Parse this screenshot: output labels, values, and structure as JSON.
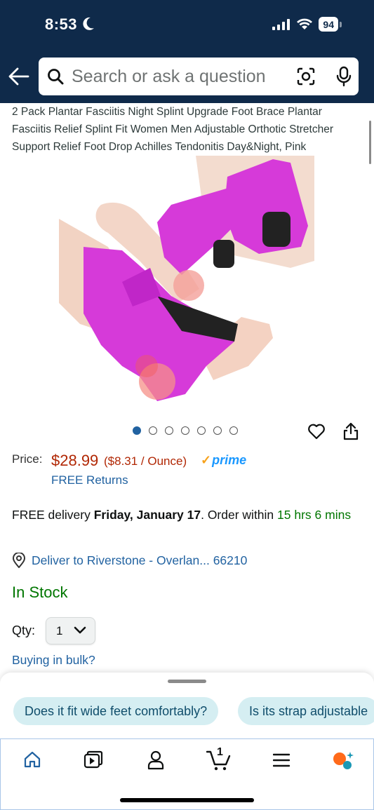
{
  "status_bar": {
    "time": "8:53",
    "battery": "94"
  },
  "search": {
    "placeholder": "Search or ask a question"
  },
  "product": {
    "title": "2 Pack Plantar Fasciitis Night Splint Upgrade Foot Brace Plantar Fasciitis Relief Splint Fit Women Men Adjustable Orthotic Stretcher Support Relief Foot Drop Achilles Tendonitis Day&Night, Pink",
    "image_count": 7,
    "active_image_index": 0
  },
  "pricing": {
    "label": "Price:",
    "price": "$28.99",
    "unit_price": "($8.31 / Ounce)",
    "prime": "prime",
    "returns": "FREE Returns"
  },
  "delivery": {
    "prefix": "FREE delivery ",
    "date": "Friday, January 17",
    "middle": ". Order within ",
    "countdown": "15 hrs 6 mins"
  },
  "location": {
    "text": "Deliver to Riverstone - Overlan... 66210"
  },
  "stock": {
    "status": "In Stock"
  },
  "quantity": {
    "label": "Qty:",
    "value": "1"
  },
  "bulk": {
    "label": "Buying in bulk?"
  },
  "suggestions": [
    {
      "text": "Does it fit wide feet comfortably?"
    },
    {
      "text": "Is its strap adjustable"
    }
  ],
  "nav": {
    "cart_count": "1",
    "items": [
      "home-icon",
      "video-icon",
      "account-icon",
      "cart-icon",
      "menu-icon",
      "rufus-icon"
    ]
  },
  "colors": {
    "header": "#0f2a4a",
    "price": "#b12704",
    "link": "#2162a1",
    "stock": "#007600",
    "product_pink": "#d63ad9"
  }
}
